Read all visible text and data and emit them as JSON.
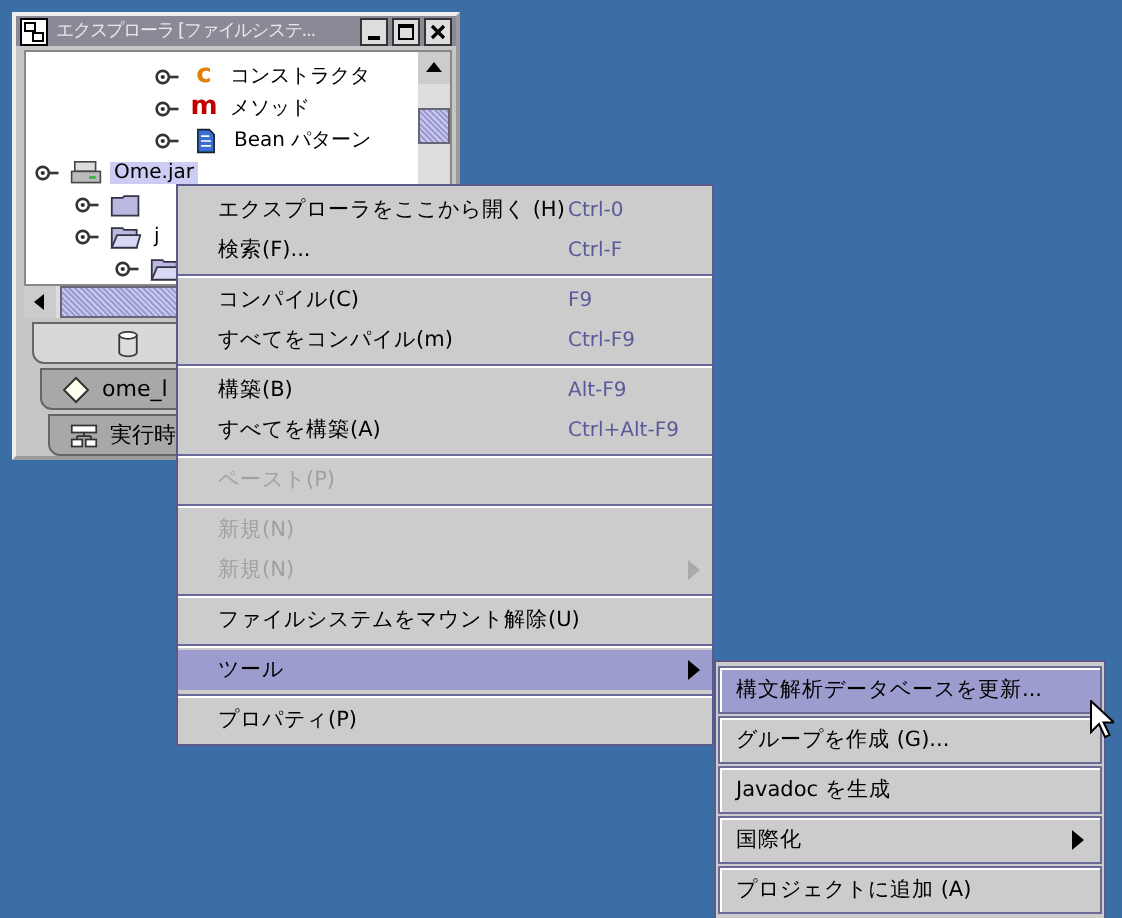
{
  "window": {
    "title": "エクスプローラ [ファイルシステ..."
  },
  "tree": [
    {
      "children": [
        {
          "children": [
            {
              "children": [
                {
                  "label": "コンストラクタ",
                  "kind": "glyph",
                  "glyph": "c",
                  "color": "#e08000",
                  "selected": false
                },
                {
                  "label": "メソッド",
                  "kind": "glyph",
                  "glyph": "m",
                  "color": "#c00000",
                  "selected": false
                },
                {
                  "label": "Bean パターン",
                  "kind": "bean",
                  "selected": false
                }
              ]
            }
          ]
        }
      ]
    },
    {
      "label": "Ome.jar",
      "kind": "jar",
      "selected": true,
      "children": [
        {
          "kind": "folder"
        },
        {
          "label": "j",
          "kind": "open",
          "selected": false,
          "children": [
            {
              "kind": "open"
            }
          ]
        }
      ]
    }
  ],
  "tabs": [
    {
      "kind": "cylinder",
      "selected": true
    },
    {
      "kind": "diamond",
      "label": "ome_l",
      "selected": false
    },
    {
      "kind": "runtime",
      "label": "実行時",
      "selected": false
    }
  ],
  "context_menu": [
    [
      {
        "label": "エクスプローラをここから開く (H)",
        "shortcut": "Ctrl-0",
        "disabled": false,
        "submenu": false,
        "selected": false
      },
      {
        "label": "検索(F)...",
        "shortcut": "Ctrl-F",
        "disabled": false,
        "submenu": false,
        "selected": false
      }
    ],
    [
      {
        "label": "コンパイル(C)",
        "shortcut": "F9",
        "disabled": false,
        "submenu": false,
        "selected": false
      },
      {
        "label": "すべてをコンパイル(m)",
        "shortcut": "Ctrl-F9",
        "disabled": false,
        "submenu": false,
        "selected": false
      }
    ],
    [
      {
        "label": "構築(B)",
        "shortcut": "Alt-F9",
        "disabled": false,
        "submenu": false,
        "selected": false
      },
      {
        "label": "すべてを構築(A)",
        "shortcut": "Ctrl+Alt-F9",
        "disabled": false,
        "submenu": false,
        "selected": false
      }
    ],
    [
      {
        "label": "ペースト(P)",
        "disabled": true,
        "submenu": false,
        "selected": false
      }
    ],
    [
      {
        "label": "新規(N)",
        "disabled": true,
        "submenu": false,
        "selected": false
      },
      {
        "label": "新規(N)",
        "disabled": true,
        "submenu": true,
        "selected": false
      }
    ],
    [
      {
        "label": "ファイルシステムをマウント解除(U)",
        "disabled": false,
        "submenu": false,
        "selected": false
      }
    ],
    [
      {
        "label": "ツール",
        "disabled": false,
        "submenu": true,
        "selected": true
      }
    ],
    [
      {
        "label": "プロパティ(P)",
        "disabled": false,
        "submenu": false,
        "selected": false
      }
    ]
  ],
  "submenu": [
    {
      "label": "構文解析データベースを更新...",
      "submenu": false,
      "selected": true
    },
    {
      "label": "グループを作成 (G)...",
      "submenu": false,
      "selected": false
    },
    {
      "label": "Javadoc を生成",
      "submenu": false,
      "selected": false
    },
    {
      "label": "国際化",
      "submenu": true,
      "selected": false
    },
    {
      "label": "プロジェクトに追加 (A)",
      "submenu": false,
      "selected": false
    }
  ]
}
